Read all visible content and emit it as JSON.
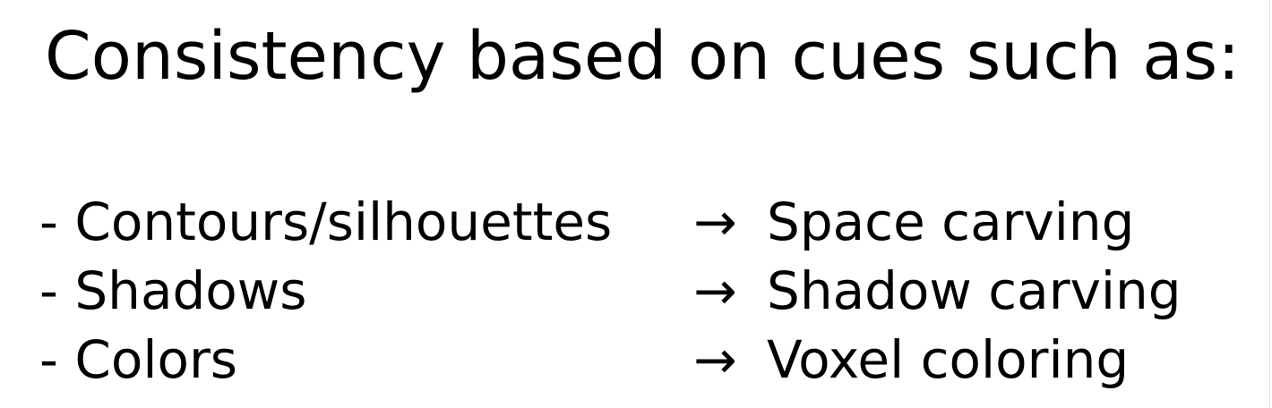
{
  "slide": {
    "title": "Consistency based on cues such as:",
    "rows": [
      {
        "cue": "- Contours/silhouettes",
        "arrow": "→",
        "method": "Space carving"
      },
      {
        "cue": "- Shadows",
        "arrow": "→",
        "method": "Shadow carving"
      },
      {
        "cue": "- Colors",
        "arrow": "→",
        "method": "Voxel coloring"
      }
    ]
  }
}
